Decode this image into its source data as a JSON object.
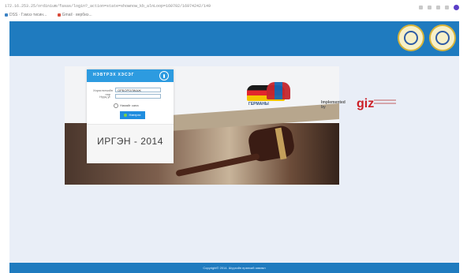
{
  "browser": {
    "url": "172.16.253.25/ordinium/fasas/login?_action=state=shownow_kb_alnLoop=160702/16974242/149",
    "bookmarks": [
      {
        "label": "DSS · Гэмээ тисин...",
        "color": "#3b82c4"
      },
      {
        "label": "Gmail · вербиэ...",
        "color": "#d94b3a"
      }
    ],
    "icons": [
      "share-icon",
      "star-icon",
      "extension-icon",
      "menu-icon",
      "profile-icon"
    ]
  },
  "header": {
    "emblems": [
      "court-emblem-icon",
      "justice-emblem-icon"
    ]
  },
  "banner": {
    "germany_label": "Германы",
    "implemented_label": "Implemented by",
    "giz_logo": "giz"
  },
  "login": {
    "title": "НЭВТРЭХ ХЭСЭГ",
    "username_label": "Хэрэглэгчийн нэр",
    "username_value": "ОРБОРОЛЖАЖ",
    "password_label": "Нууц үг",
    "password_value": "",
    "remember_label": "Намайг сана",
    "button_label": "Нэвтрэх",
    "year_text": "ИРГЭН - 2014"
  },
  "footer": {
    "copyright": "Copyright© 2014. Шүүхийн ерөнхий зөвлөл"
  },
  "colors": {
    "header_blue": "#1f7bbf",
    "login_header": "#2d9be0",
    "button": "#1f8ddf",
    "page_bg": "#e9eef7"
  }
}
